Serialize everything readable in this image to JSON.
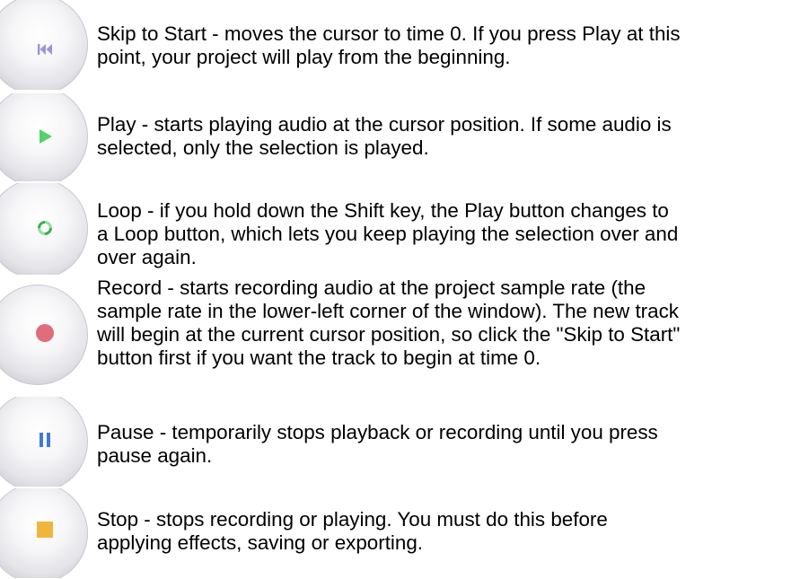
{
  "colors": {
    "skip": "#9a96d8",
    "play": "#55d36a",
    "loop_light": "#8fe09a",
    "loop_dark": "#3fae55",
    "record": "#e06e7a",
    "pause": "#3f7bd6",
    "stop": "#f0b53c"
  },
  "items": [
    {
      "icon": "skip-to-start-icon",
      "text": "Skip to Start - moves the cursor to time 0. If you press Play at this\npoint, your project will play from the beginning."
    },
    {
      "icon": "play-icon",
      "text": "Play - starts playing audio at the cursor position. If some audio is\nselected, only the selection is played."
    },
    {
      "icon": "loop-icon",
      "text": "Loop - if you hold down the Shift key, the Play button changes to\na Loop button, which lets you keep playing the selection over and\nover again."
    },
    {
      "icon": "record-icon",
      "text": "Record - starts recording audio at the project sample rate (the\nsample rate in the lower-left corner of the window). The new track\nwill begin at the current cursor position, so click the \"Skip to Start\"\nbutton first if you want the track to begin at time 0."
    },
    {
      "icon": "pause-icon",
      "text": "Pause - temporarily stops playback or recording until you press\npause again."
    },
    {
      "icon": "stop-icon",
      "text": "Stop - stops recording or playing. You must do this before\napplying effects, saving or exporting."
    }
  ]
}
